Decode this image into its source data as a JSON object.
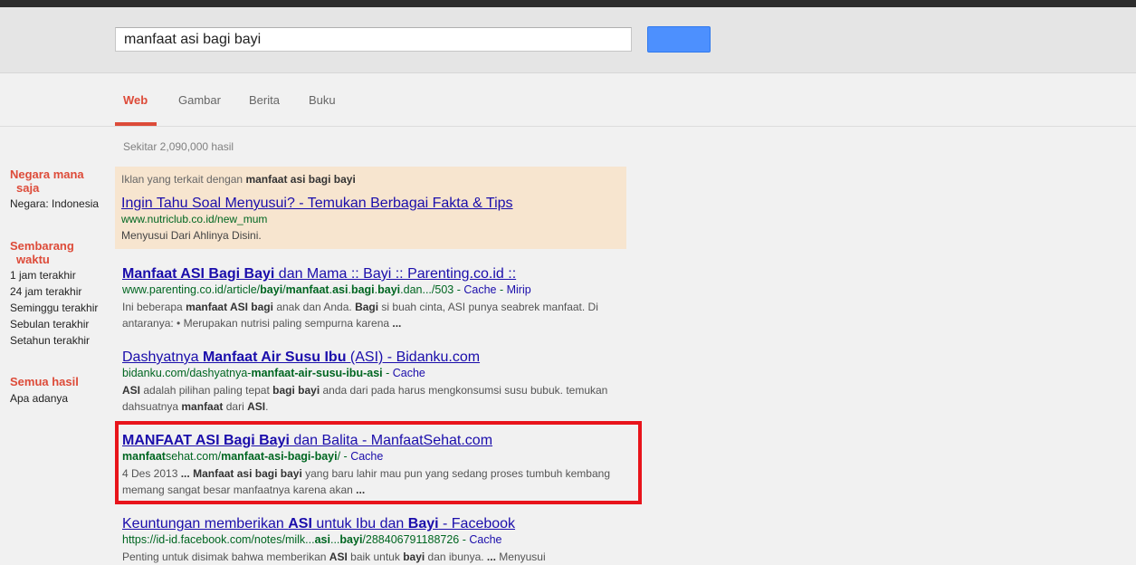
{
  "search": {
    "query": "manfaat asi bagi bayi"
  },
  "tabs": [
    "Web",
    "Gambar",
    "Berita",
    "Buku"
  ],
  "stats": "Sekitar 2,090,000 hasil",
  "sidebar": {
    "country_heading_1": "Negara mana",
    "country_heading_2": "saja",
    "country_item": "Negara: Indonesia",
    "time_heading_1": "Sembarang",
    "time_heading_2": "waktu",
    "time_items": [
      "1 jam terakhir",
      "24 jam terakhir",
      "Seminggu terakhir",
      "Sebulan terakhir",
      "Setahun terakhir"
    ],
    "results_heading": "Semua hasil",
    "results_item": "Apa adanya"
  },
  "ad": {
    "label_prefix": "Iklan yang terkait dengan ",
    "label_query": "manfaat asi bagi bayi",
    "title": "Ingin Tahu Soal Menyusui? - Temukan Berbagai Fakta & Tips",
    "url": "www.nutriclub.co.id/new_mum",
    "description": "Menyusui Dari Ahlinya Disini."
  },
  "results": [
    {
      "title_bold": "Manfaat ASI Bagi Bayi",
      "title_rest": " dan Mama :: Bayi :: Parenting.co.id ::",
      "url_p1": "www.parenting.co.id/article/",
      "url_b1": "bayi",
      "url_p2": "/",
      "url_b2": "manfaat",
      "url_p3": ".",
      "url_b3": "asi",
      "url_p4": ".",
      "url_b4": "bagi",
      "url_p5": ".",
      "url_b5": "bayi",
      "url_p6": ".dan.../503",
      "sep": " - ",
      "cache": "Cache",
      "similar": "Mirip",
      "snip_1": "Ini beberapa ",
      "snip_b1": "manfaat ASI bagi",
      "snip_2": " anak dan Anda. ",
      "snip_b2": "Bagi",
      "snip_3": " si buah cinta, ASI punya seabrek manfaat. Di antaranya: • Merupakan nutrisi paling sempurna karena ",
      "snip_b3": "..."
    },
    {
      "title_p1": "Dashyatnya ",
      "title_b1": "Manfaat Air Susu Ibu",
      "title_p2": " (ASI) - Bidanku.com",
      "url_p1": "bidanku.com/dashyatnya-",
      "url_b1": "manfaat-air-susu-ibu-asi",
      "sep": " - ",
      "cache": "Cache",
      "snip_b1": "ASI",
      "snip_1": " adalah pilihan paling tepat ",
      "snip_b2": "bagi bayi",
      "snip_2": " anda dari pada harus mengkonsumsi susu bubuk. temukan dahsuatnya ",
      "snip_b3": "manfaat",
      "snip_3": " dari ",
      "snip_b4": "ASI",
      "snip_4": "."
    },
    {
      "title_bold": "MANFAAT ASI Bagi Bayi",
      "title_rest": " dan Balita - ManfaatSehat.com",
      "url_b1": "manfaat",
      "url_p1": "sehat.com/",
      "url_b2": "manfaat-asi-bagi-bayi",
      "url_p2": "/",
      "sep": " - ",
      "cache": "Cache",
      "snip_1": "4 Des 2013 ",
      "snip_b1": "...",
      "snip_2": " ",
      "snip_b2": "Manfaat asi bagi bayi",
      "snip_3": " yang baru lahir mau pun yang sedang proses tumbuh kembang memang sangat besar manfaatnya karena akan ",
      "snip_b3": "..."
    },
    {
      "title_p1": "Keuntungan memberikan ",
      "title_b1": "ASI",
      "title_p2": " untuk Ibu dan ",
      "title_b2": "Bayi",
      "title_p3": " - Facebook",
      "url_p1": "https://id-id.facebook.com/notes/milk...",
      "url_b1": "asi",
      "url_p2": "...",
      "url_b2": "bayi",
      "url_p3": "/288406791188726",
      "sep": " - ",
      "cache": "Cache",
      "snip_1": "Penting untuk disimak bahwa memberikan ",
      "snip_b1": "ASI",
      "snip_2": " baik untuk ",
      "snip_b2": "bayi",
      "snip_3": " dan ibunya. ",
      "snip_b3": "...",
      "snip_4": " Menyusui"
    }
  ],
  "colors": {
    "accent": "#dd4b39",
    "link": "#1a0dab",
    "url": "#006621",
    "search_button": "#4d90fe",
    "highlight_box": "#e8141b",
    "ad_background": "#f7e5cf"
  }
}
